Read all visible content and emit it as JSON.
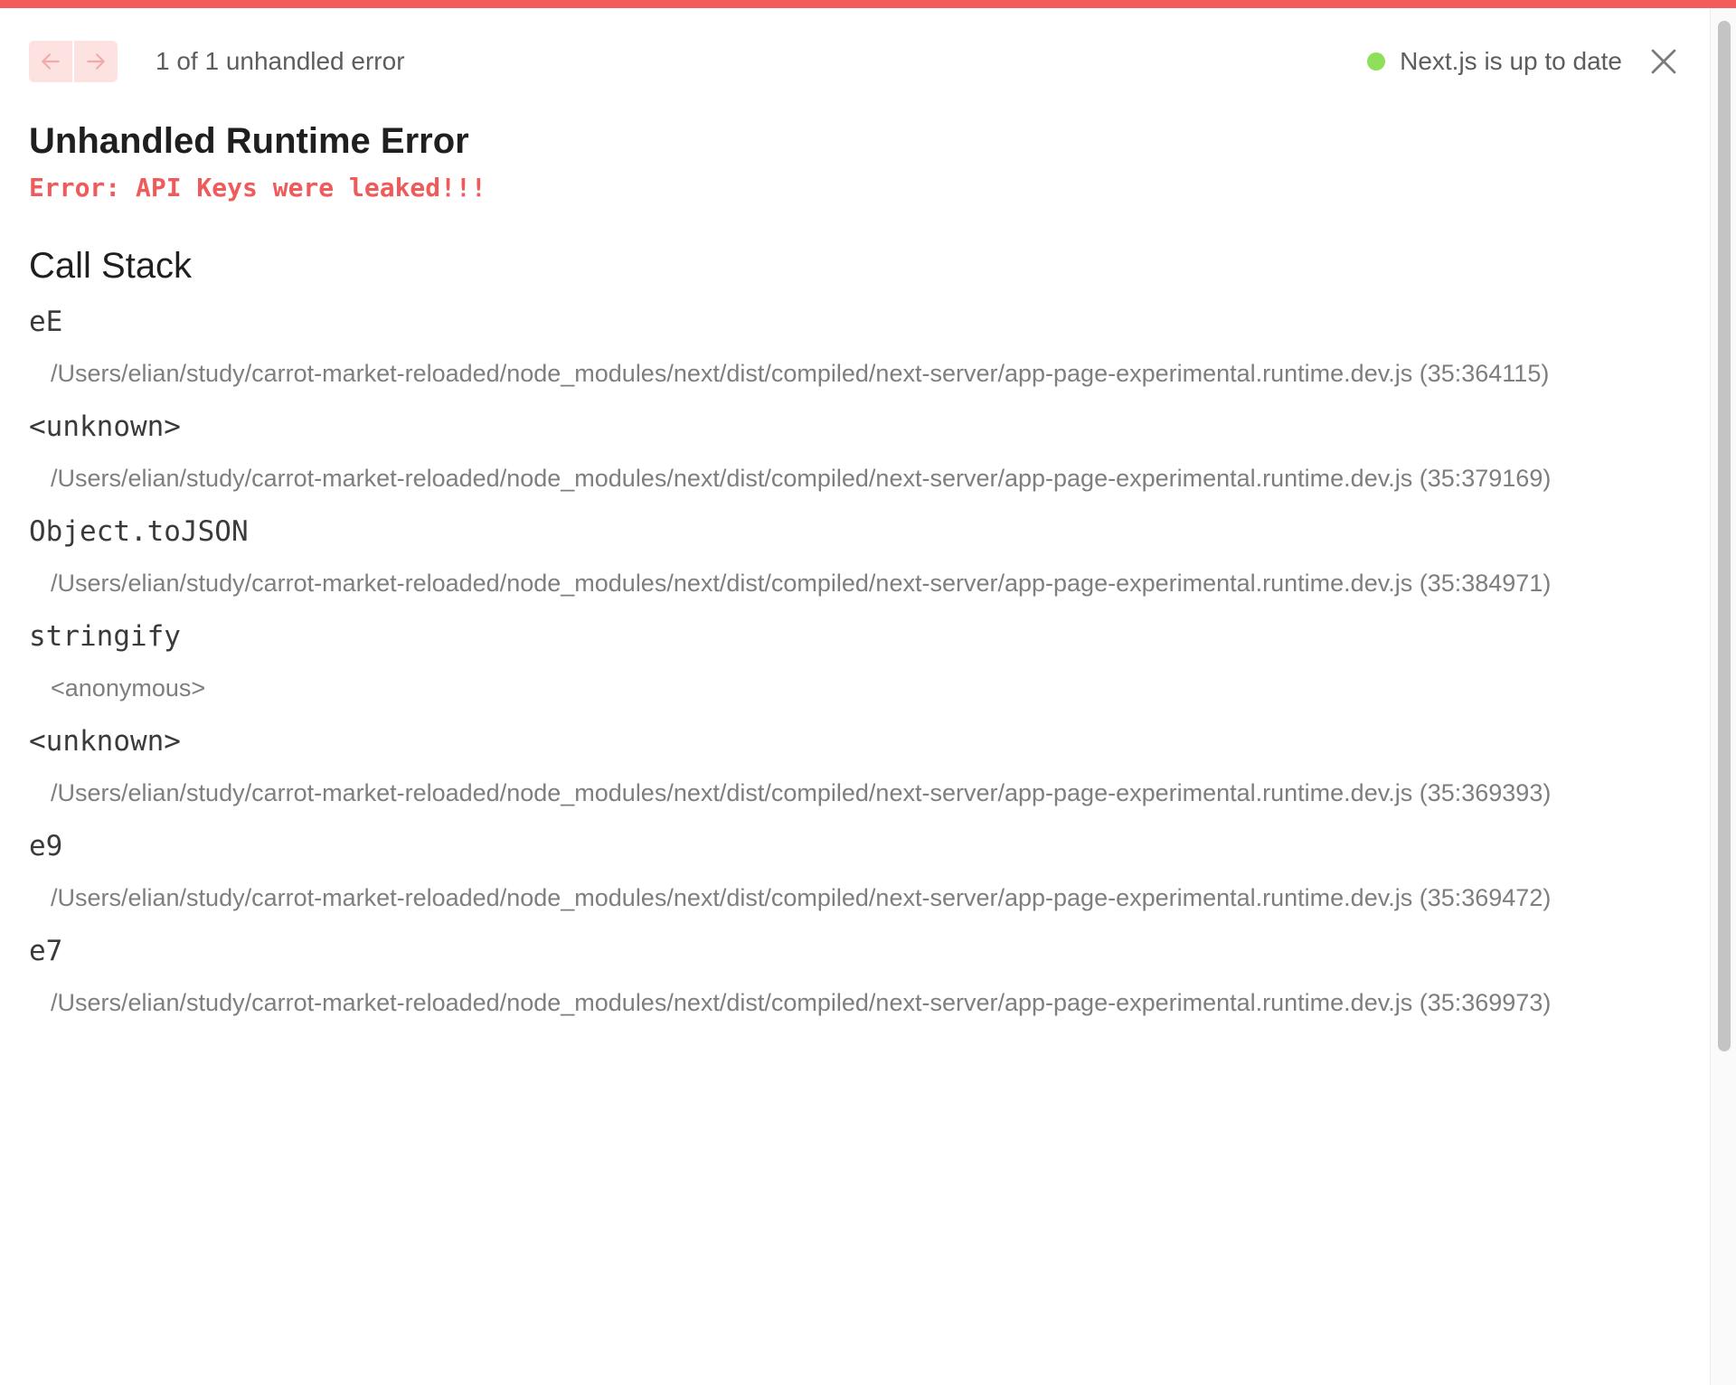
{
  "header": {
    "counter_text": "1 of 1 unhandled error",
    "status_text": "Next.js is up to date",
    "status_color": "#8ee05a",
    "accent_color": "#f25c5c"
  },
  "error": {
    "title": "Unhandled Runtime Error",
    "message": "Error: API Keys were leaked!!!"
  },
  "call_stack": {
    "title": "Call Stack",
    "frames": [
      {
        "fn": "eE",
        "loc": "/Users/elian/study/carrot-market-reloaded/node_modules/next/dist/compiled/next-server/app-page-experimental.runtime.dev.js (35:364115)"
      },
      {
        "fn": "<unknown>",
        "loc": "/Users/elian/study/carrot-market-reloaded/node_modules/next/dist/compiled/next-server/app-page-experimental.runtime.dev.js (35:379169)"
      },
      {
        "fn": "Object.toJSON",
        "loc": "/Users/elian/study/carrot-market-reloaded/node_modules/next/dist/compiled/next-server/app-page-experimental.runtime.dev.js (35:384971)"
      },
      {
        "fn": "stringify",
        "loc": "<anonymous>"
      },
      {
        "fn": "<unknown>",
        "loc": "/Users/elian/study/carrot-market-reloaded/node_modules/next/dist/compiled/next-server/app-page-experimental.runtime.dev.js (35:369393)"
      },
      {
        "fn": "e9",
        "loc": "/Users/elian/study/carrot-market-reloaded/node_modules/next/dist/compiled/next-server/app-page-experimental.runtime.dev.js (35:369472)"
      },
      {
        "fn": "e7",
        "loc": "/Users/elian/study/carrot-market-reloaded/node_modules/next/dist/compiled/next-server/app-page-experimental.runtime.dev.js (35:369973)"
      }
    ]
  },
  "icons": {
    "prev": "arrow-left-icon",
    "next": "arrow-right-icon",
    "close": "close-icon"
  }
}
